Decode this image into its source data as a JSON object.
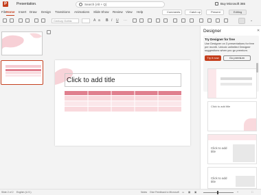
{
  "app": {
    "logo": "P",
    "title": "Presentation",
    "search_placeholder": "Search (Alt + Q)",
    "buy_label": "Buy Microsoft 365"
  },
  "tabs": [
    "File",
    "Home",
    "Insert",
    "Draw",
    "Design",
    "Transitions",
    "Animations",
    "Slide Show",
    "Review",
    "View",
    "Help"
  ],
  "active_tab": "Home",
  "ribbon": {
    "comments_label": "Comments",
    "catchup_label": "Catch up",
    "present_label": "Present",
    "editing_label": "Editing",
    "font_placeholder": "Century Gothic"
  },
  "thumbnails": {
    "slide1_number": "1",
    "slide2_number": "2"
  },
  "slide": {
    "title_placeholder": "Click to add title"
  },
  "designer": {
    "title": "Designer",
    "card_heading": "Try Designer for free",
    "card_description": "Use Designer on 3 presentations for free per month. Unlock unlimited Designer suggestions when you go premium.",
    "try_button": "Try it now",
    "premium_button": "Go premium",
    "suggestion_2_text": "Click to add title",
    "suggestion_3_text": "Click to add title",
    "suggestion_4_text": "Click to add title"
  },
  "status": {
    "slide_info": "Slide 2 of 2",
    "language": "English (U.S.)",
    "notes_label": "Notes",
    "feedback_label": "Give Feedback to Microsoft"
  },
  "colors": {
    "accent": "#c43e1c",
    "table_header": "#e07f8e",
    "table_row": "#f9d9dd",
    "pink_brush": "#f6cbd1"
  }
}
